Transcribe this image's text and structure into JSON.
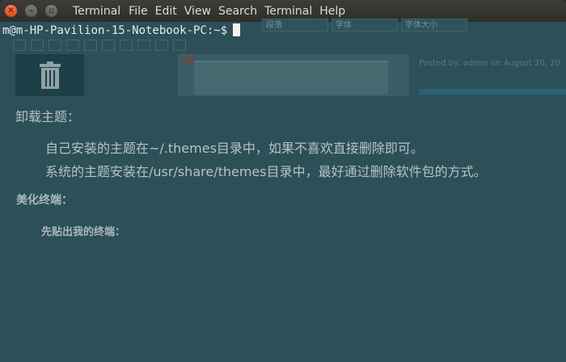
{
  "window": {
    "title": "Terminal",
    "menu": [
      "File",
      "Edit",
      "View",
      "Search",
      "Terminal",
      "Help"
    ]
  },
  "terminal": {
    "prompt": "m@m-HP-Pavilion-15-Notebook-PC:~$"
  },
  "background": {
    "toolbar_selects": [
      "段落",
      "字体",
      "字体大小"
    ],
    "post_meta": "Posted by: admin    on August 20, 20",
    "heading1": "卸载主题：",
    "paragraph1": "自己安装的主题在~/.themes目录中，如果不喜欢直接删除即可。",
    "paragraph2": "系统的主题安装在/usr/share/themes目录中，最好通过删除软件包的方式。",
    "heading2": "美化终端：",
    "heading3": "先贴出我的终端："
  },
  "colors": {
    "terminal_bg": "#2c4f58",
    "titlebar_bg": "#3d3c39",
    "close_button": "#dd4814"
  }
}
